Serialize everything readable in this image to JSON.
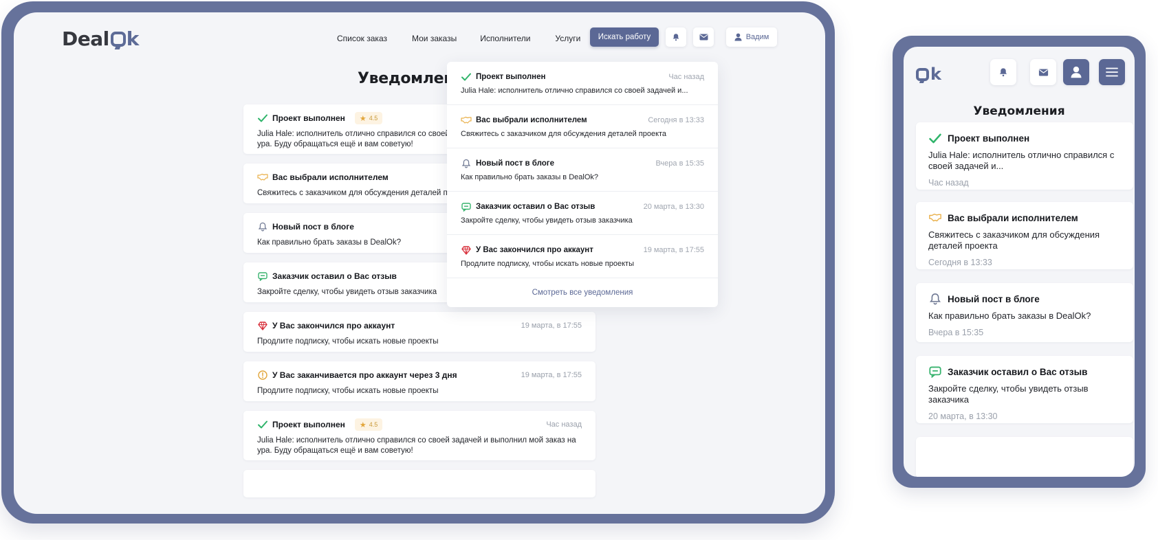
{
  "desktop": {
    "logo": {
      "part1": "Deal",
      "part2": "k"
    },
    "nav": [
      "Список заказ",
      "Мои заказы",
      "Исполнители",
      "Услуги"
    ],
    "cta": "Искать работу",
    "user": "Вадим",
    "page_title": "Уведомления",
    "notifications": [
      {
        "icon": "check-icon",
        "title": "Проект выполнен",
        "rating": "4.5",
        "time": "",
        "body": "Julia Hale: исполнитель отлично справился со своей задачей и выполнил мой заказ на ура. Буду обращаться ещё и вам советую!"
      },
      {
        "icon": "handshake-icon",
        "title": "Вас выбрали исполнителем",
        "time": "",
        "body": "Свяжитесь с заказчиком для обсуждения деталей проекта"
      },
      {
        "icon": "bell-outline-icon",
        "title": "Новый пост в блоге",
        "time": "",
        "body": "Как правильно брать заказы в DealOk?"
      },
      {
        "icon": "chat-icon",
        "title": "Заказчик оставил о Вас отзыв",
        "time": "",
        "body": "Закройте сделку, чтобы увидеть отзыв заказчика"
      },
      {
        "icon": "diamond-icon",
        "title": "У Вас закончился про аккаунт",
        "time": "19 марта, в 17:55",
        "body": "Продлите подписку, чтобы искать новые проекты"
      },
      {
        "icon": "warning-icon",
        "title": "У Вас заканчивается про аккаунт через 3 дня",
        "time": "19 марта, в 17:55",
        "body": "Продлите подписку, чтобы искать новые проекты"
      },
      {
        "icon": "check-icon",
        "title": "Проект выполнен",
        "rating": "4.5",
        "time": "Час назад",
        "body": "Julia Hale: исполнитель отлично справился со своей задачей и выполнил мой заказ на ура. Буду обращаться ещё и вам советую!"
      }
    ],
    "dropdown": {
      "items": [
        {
          "icon": "check-icon",
          "title": "Проект выполнен",
          "time": "Час назад",
          "body": "Julia Hale: исполнитель отлично справился со своей задачей и..."
        },
        {
          "icon": "handshake-icon",
          "title": "Вас выбрали исполнителем",
          "time": "Сегодня в 13:33",
          "body": "Свяжитесь с заказчиком для обсуждения деталей проекта"
        },
        {
          "icon": "bell-outline-icon",
          "title": "Новый пост в блоге",
          "time": "Вчера в 15:35",
          "body": "Как правильно брать заказы в DealOk?"
        },
        {
          "icon": "chat-icon",
          "title": "Заказчик оставил о Вас отзыв",
          "time": "20 марта, в 13:30",
          "body": "Закройте сделку, чтобы увидеть отзыв заказчика"
        },
        {
          "icon": "diamond-icon",
          "title": "У Вас закончился про аккаунт",
          "time": "19 марта, в 17:55",
          "body": "Продлите подписку, чтобы искать новые проекты"
        }
      ],
      "footer": "Смотреть все уведомления"
    }
  },
  "mobile": {
    "logo": "k",
    "title": "Уведомления",
    "notifications": [
      {
        "icon": "check-icon",
        "title": "Проект выполнен",
        "body": "Julia Hale: исполнитель отлично справился с своей задачей и...",
        "time": "Час назад"
      },
      {
        "icon": "handshake-icon",
        "title": "Вас выбрали исполнителем",
        "body": "Свяжитесь с заказчиком для обсуждения деталей проекта",
        "time": "Сегодня в 13:33"
      },
      {
        "icon": "bell-outline-icon",
        "title": "Новый пост в блоге",
        "body": "Как правильно брать заказы в DealOk?",
        "time": "Вчера в 15:35"
      },
      {
        "icon": "chat-icon",
        "title": "Заказчик оставил о Вас отзыв",
        "body": "Закройте сделку, чтобы увидеть отзыв заказчика",
        "time": "20 марта, в 13:30"
      }
    ]
  },
  "colors": {
    "brand": "#5b6895",
    "frame": "#66729b",
    "check": "#2fb46a",
    "diamond": "#d8313c",
    "warning": "#e2a53a",
    "handshake": "#e9b04a",
    "chat": "#38b36e",
    "muted": "#9aa0ab"
  }
}
